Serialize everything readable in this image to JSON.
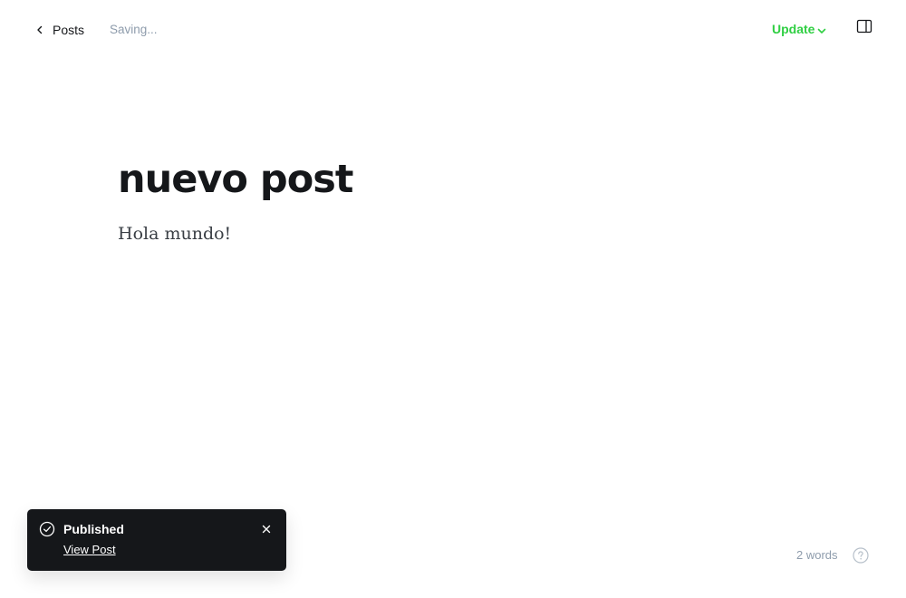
{
  "header": {
    "back_label": "Posts",
    "status_text": "Saving...",
    "update_label": "Update"
  },
  "editor": {
    "title": "nuevo post",
    "body": "Hola mundo!"
  },
  "toast": {
    "title": "Published",
    "link_label": "View Post"
  },
  "footer": {
    "word_count": "2 words"
  },
  "icons": {
    "back": "chevron-left-icon",
    "update_dropdown": "chevron-down-icon",
    "sidebar": "sidebar-panel-icon",
    "toast_status": "check-circle-icon",
    "toast_close": "close-icon",
    "help": "help-circle-icon"
  },
  "colors": {
    "accent": "#30cf43",
    "text": "#15171a",
    "muted": "#8e9cac",
    "toast_bg": "#15171a"
  }
}
